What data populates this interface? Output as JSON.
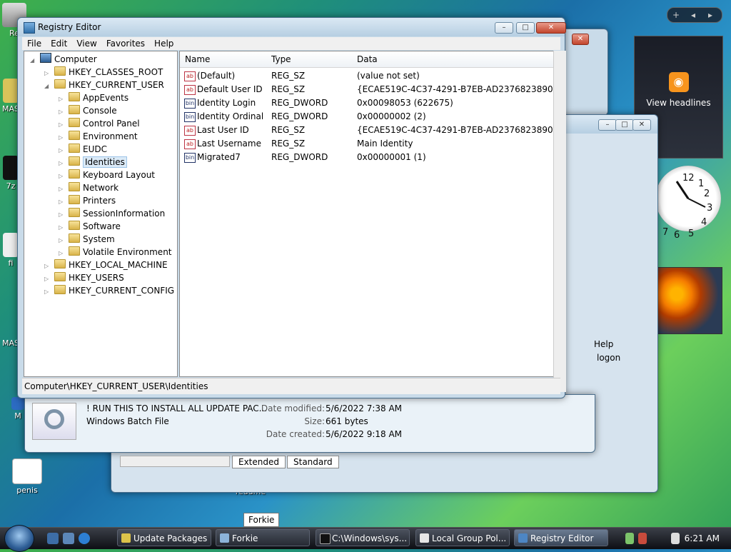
{
  "registry": {
    "title": "Registry Editor",
    "menu": [
      "File",
      "Edit",
      "View",
      "Favorites",
      "Help"
    ],
    "tree": [
      {
        "label": "Computer",
        "level": 0,
        "expanded": true,
        "icon": "computer-icon"
      },
      {
        "label": "HKEY_CLASSES_ROOT",
        "level": 1
      },
      {
        "label": "HKEY_CURRENT_USER",
        "level": 1,
        "expanded": true
      },
      {
        "label": "AppEvents",
        "level": 2
      },
      {
        "label": "Console",
        "level": 2
      },
      {
        "label": "Control Panel",
        "level": 2
      },
      {
        "label": "Environment",
        "level": 2
      },
      {
        "label": "EUDC",
        "level": 2
      },
      {
        "label": "Identities",
        "level": 2,
        "selected": true
      },
      {
        "label": "Keyboard Layout",
        "level": 2
      },
      {
        "label": "Network",
        "level": 2
      },
      {
        "label": "Printers",
        "level": 2
      },
      {
        "label": "SessionInformation",
        "level": 2
      },
      {
        "label": "Software",
        "level": 2
      },
      {
        "label": "System",
        "level": 2
      },
      {
        "label": "Volatile Environment",
        "level": 2
      },
      {
        "label": "HKEY_LOCAL_MACHINE",
        "level": 1
      },
      {
        "label": "HKEY_USERS",
        "level": 1
      },
      {
        "label": "HKEY_CURRENT_CONFIG",
        "level": 1
      }
    ],
    "columns": [
      "Name",
      "Type",
      "Data"
    ],
    "values": [
      {
        "icon": "ab",
        "name": "(Default)",
        "type": "REG_SZ",
        "data": "(value not set)"
      },
      {
        "icon": "ab",
        "name": "Default User ID",
        "type": "REG_SZ",
        "data": "{ECAE519C-4C37-4291-B7EB-AD2376823890}"
      },
      {
        "icon": "bin",
        "name": "Identity Login",
        "type": "REG_DWORD",
        "data": "0x00098053 (622675)"
      },
      {
        "icon": "bin",
        "name": "Identity Ordinal",
        "type": "REG_DWORD",
        "data": "0x00000002 (2)"
      },
      {
        "icon": "ab",
        "name": "Last User ID",
        "type": "REG_SZ",
        "data": "{ECAE519C-4C37-4291-B7EB-AD2376823890}"
      },
      {
        "icon": "ab",
        "name": "Last Username",
        "type": "REG_SZ",
        "data": "Main Identity"
      },
      {
        "icon": "bin",
        "name": "Migrated7",
        "type": "REG_DWORD",
        "data": "0x00000001 (1)"
      }
    ],
    "status": "Computer\\HKEY_CURRENT_USER\\Identities"
  },
  "file_info": {
    "name": "! RUN THIS TO INSTALL ALL UPDATE PAC...",
    "type": "Windows Batch File",
    "modified_label": "Date modified:",
    "modified": "5/6/2022 7:38 AM",
    "size_label": "Size:",
    "size": "661 bytes",
    "created_label": "Date created:",
    "created": "5/6/2022 9:18 AM"
  },
  "background_window": {
    "help_text": "Help",
    "logon_text": "logon",
    "tabs": [
      "Extended",
      "Standard"
    ]
  },
  "desktop_icons": [
    "Re",
    "MAS",
    "7z",
    "fi",
    "MAS",
    "M",
    "penis",
    "readme"
  ],
  "sidebar": {
    "feed_label": "View headlines",
    "controls": [
      "+",
      "◂",
      "▸"
    ]
  },
  "clock_numbers": [
    "12",
    "1",
    "2",
    "3",
    "4",
    "5",
    "6",
    "7"
  ],
  "tooltip": "Forkie",
  "taskbar": {
    "buttons": [
      "Update Packages",
      "Forkie",
      "C:\\Windows\\sys...",
      "Local Group Pol...",
      "Registry Editor"
    ],
    "time": "6:21 AM"
  }
}
